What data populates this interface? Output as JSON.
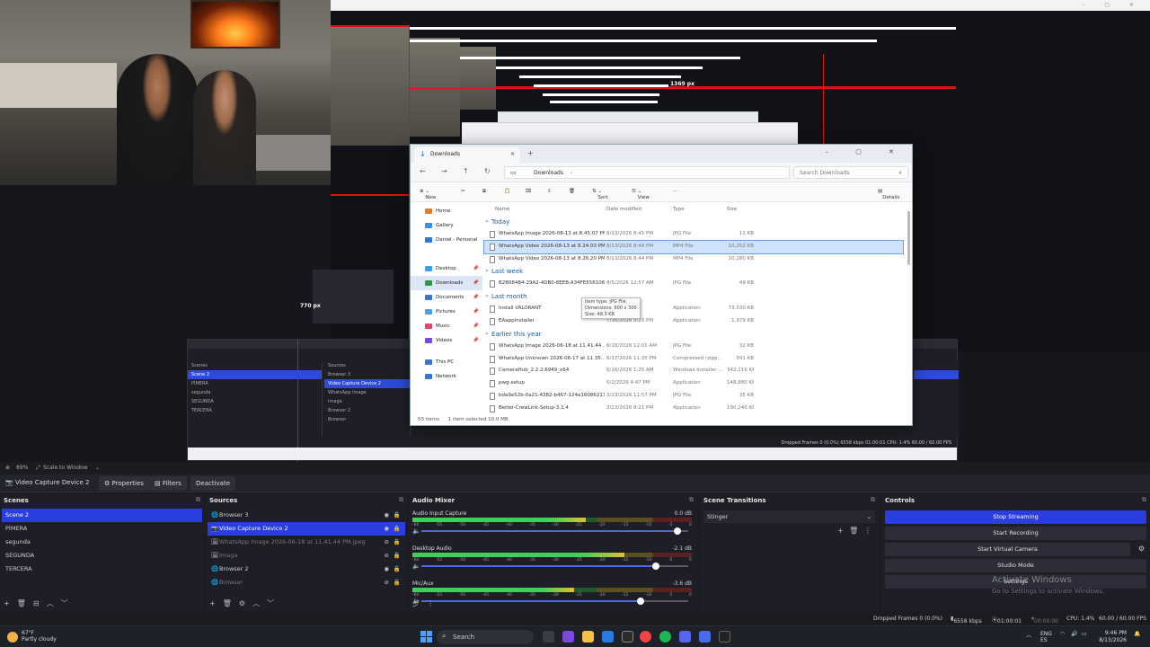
{
  "preview": {
    "nest_label_width": "1369 px",
    "nest_label_height": "770 px"
  },
  "explorer": {
    "tab_title": "Downloads",
    "address": "Downloads",
    "search_placeholder": "Search Downloads",
    "cmd": {
      "new": "New",
      "sort": "Sort",
      "view": "View",
      "more": "···",
      "details": "Details"
    },
    "sidebar": [
      {
        "label": "Home",
        "color": "#e07b2a"
      },
      {
        "label": "Gallery",
        "color": "#3a8fe0"
      },
      {
        "label": "Daniel - Personal",
        "color": "#2a7be0"
      },
      {
        "label": "Desktop",
        "color": "#3aa0e8"
      },
      {
        "label": "Downloads",
        "color": "#2a9a4a"
      },
      {
        "label": "Documents",
        "color": "#3a78d0"
      },
      {
        "label": "Pictures",
        "color": "#4aa0e0"
      },
      {
        "label": "Music",
        "color": "#e04a6a"
      },
      {
        "label": "Videos",
        "color": "#7a4ae0"
      },
      {
        "label": "This PC",
        "color": "#3a78d0"
      },
      {
        "label": "Network",
        "color": "#3a78d0"
      }
    ],
    "columns": {
      "name": "Name",
      "modified": "Date modified",
      "type": "Type",
      "size": "Size"
    },
    "groups": {
      "today": "Today",
      "last_week": "Last week",
      "last_month": "Last month",
      "earlier": "Earlier this year"
    },
    "files_today": [
      {
        "name": "WhatsApp Image 2026-08-13 at 8.45.07 PM",
        "date": "8/13/2026 8:45 PM",
        "type": "JPG File",
        "size": "11 KB"
      },
      {
        "name": "WhatsApp Video 2026-08-13 at 8.24.03 PM",
        "date": "8/13/2026 8:44 PM",
        "type": "MP4 File",
        "size": "10,252 KB"
      },
      {
        "name": "WhatsApp Video 2026-08-13 at 8.26.20 PM",
        "date": "8/13/2026 8:44 PM",
        "type": "MP4 File",
        "size": "10,280 KB"
      }
    ],
    "files_last_week": [
      {
        "name": "B2B08484-29A2-4DB0-8EEB-A34FE5561065",
        "date": "8/5/2026 12:57 AM",
        "type": "JPG File",
        "size": "49 KB"
      }
    ],
    "files_last_month": [
      {
        "name": "Install VALORANT",
        "date": "...7 PM",
        "type": "Application",
        "size": "73,030 KB"
      },
      {
        "name": "EAappInstaller",
        "date": "7/16/2026 3:23 PM",
        "type": "Application",
        "size": "1,979 KB"
      }
    ],
    "files_earlier": [
      {
        "name": "WhatsApp Image 2026-06-18 at 11.41.44 ...",
        "date": "6/18/2026 12:01 AM",
        "type": "JPG File",
        "size": "32 KB"
      },
      {
        "name": "WhatsApp Unknown 2026-06-17 at 11.35....",
        "date": "6/17/2026 11:35 PM",
        "type": "Compressed (zipp...",
        "size": "591 KB"
      },
      {
        "name": "CameraHub_2.2.2.6949_x64",
        "date": "6/16/2026 1:25 AM",
        "type": "Windows Installer ...",
        "size": "342,116 KB"
      },
      {
        "name": "pwg-setup",
        "date": "6/2/2026 4:47 PM",
        "type": "Application",
        "size": "148,880 KB"
      },
      {
        "name": "bda9e52b-0a21-4382-b467-124e16086213",
        "date": "3/23/2026 11:57 PM",
        "type": "JPG File",
        "size": "35 KB"
      },
      {
        "name": "Better-CrewLink-Setup-3.1.4",
        "date": "3/23/2026 8:21 PM",
        "type": "Application",
        "size": "190,240 KB"
      }
    ],
    "tooltip": [
      "Item type: JPG File",
      "Dimensions: 600 x 300",
      "Size: 48.3 KB"
    ],
    "status_items": "53 items",
    "status_selected": "1 item selected  10.0 MB"
  },
  "scalebar": {
    "zoom": "89%",
    "mode": "Scale to Window"
  },
  "source_bar": {
    "name": "Video Capture Device 2",
    "properties": "Properties",
    "filters": "Filters",
    "deactivate": "Deactivate"
  },
  "scenes": {
    "title": "Scenes",
    "items": [
      "Scene 2",
      "PÍMERA",
      "segunda",
      "SEGUNDA",
      "TERCERA"
    ]
  },
  "sources": {
    "title": "Sources",
    "items": [
      {
        "label": "Browser 3",
        "icon": "🌐",
        "visible": true
      },
      {
        "label": "Video Capture Device 2",
        "icon": "📷",
        "visible": true
      },
      {
        "label": "WhatsApp Image 2026-06-18 at 11.41.44 PM.jpeg",
        "icon": "🖼",
        "visible": false
      },
      {
        "label": "Imaga",
        "icon": "🖼",
        "visible": false
      },
      {
        "label": "Browser 2",
        "icon": "🌐",
        "visible": true
      },
      {
        "label": "Browser",
        "icon": "🌐",
        "visible": false
      }
    ]
  },
  "mixer": {
    "title": "Audio Mixer",
    "channels": [
      {
        "name": "Audio Input Capture",
        "db": "0.0 dB",
        "level": 0.62,
        "volume": 0.96
      },
      {
        "name": "Desktop Audio",
        "db": "-2.1 dB",
        "level": 0.76,
        "volume": 0.88
      },
      {
        "name": "Mic/Aux",
        "db": "-3.6 dB",
        "level": 0.58,
        "volume": 0.82
      }
    ],
    "ticks": [
      "-60",
      "-55",
      "-50",
      "-45",
      "-40",
      "-35",
      "-30",
      "-25",
      "-20",
      "-15",
      "-10",
      "-5",
      "0"
    ]
  },
  "transitions": {
    "title": "Scene Transitions",
    "selected": "Stinger"
  },
  "controls": {
    "title": "Controls",
    "stop_streaming": "Stop Streaming",
    "start_recording": "Start Recording",
    "start_virtual_camera": "Start Virtual Camera",
    "studio_mode": "Studio Mode",
    "settings": "Settings",
    "activate_title": "Activate Windows",
    "activate_sub": "Go to Settings to activate Windows."
  },
  "status": {
    "dropped": "Dropped Frames 0 (0.0%)",
    "kbps": "6558 kbps",
    "live": "01:00:01",
    "rec": "00:00:00",
    "cpu": "CPU: 1.4%",
    "fps": "60.00 / 60.00 FPS"
  },
  "taskbar": {
    "temp": "67°F",
    "weather": "Partly cloudy",
    "search": "Search",
    "lang": "ENG",
    "lang2": "ES",
    "time": "9:46 PM",
    "date": "8/13/2026"
  }
}
